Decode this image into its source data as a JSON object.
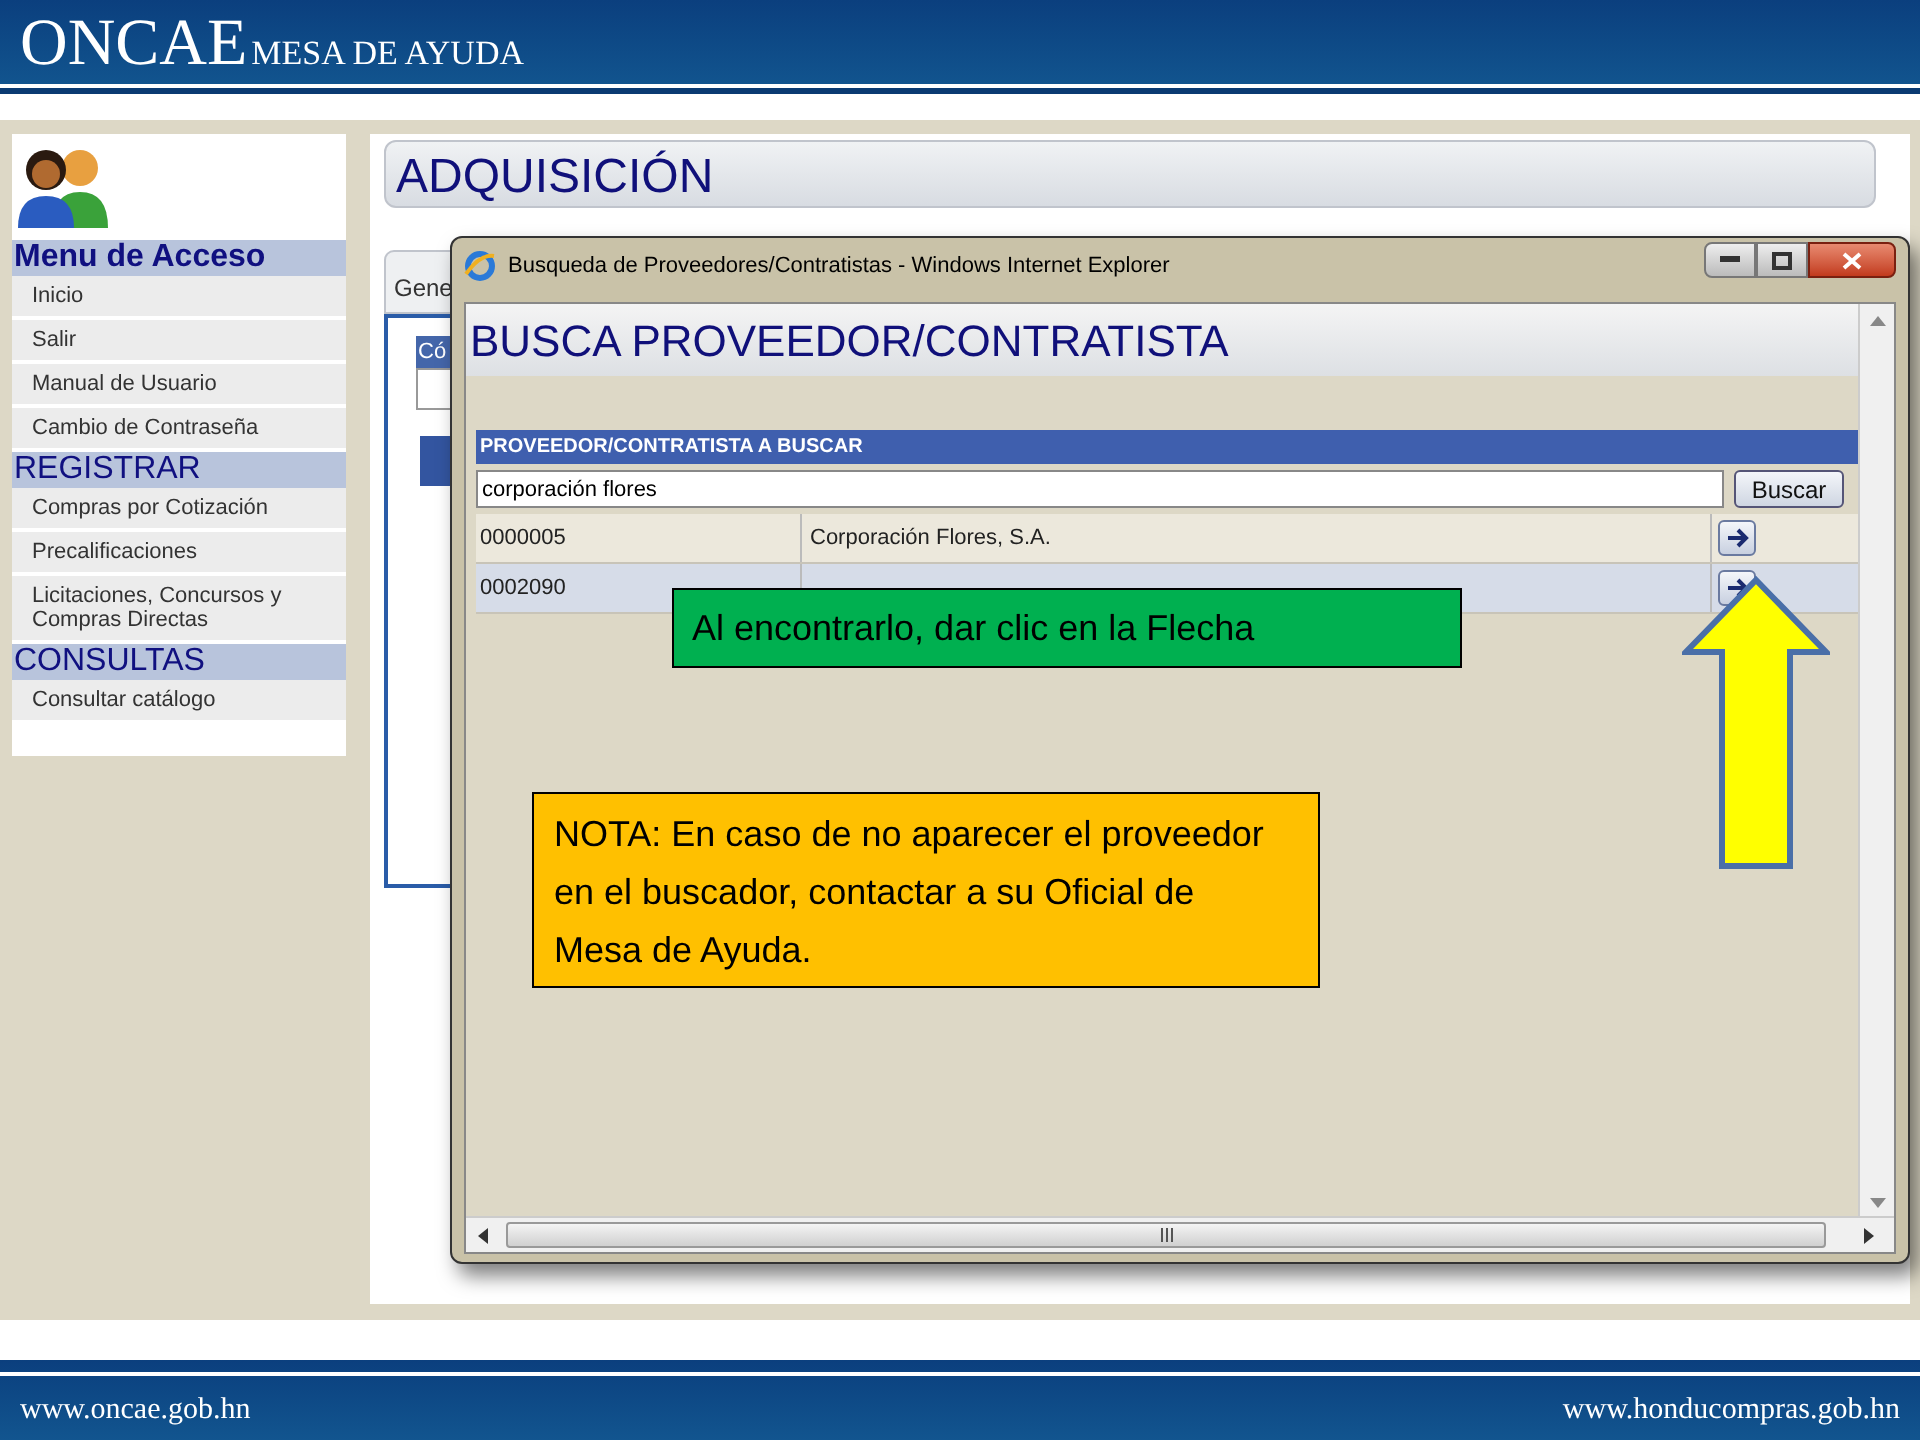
{
  "header": {
    "brand": "ONCAE",
    "subtitle": "MESA DE AYUDA"
  },
  "sidebar": {
    "sections": [
      {
        "title": "Menu de Acceso",
        "kind": "main",
        "items": [
          "Inicio",
          "Salir",
          "Manual de Usuario",
          "Cambio de Contraseña"
        ]
      },
      {
        "title": "REGISTRAR",
        "kind": "group",
        "items": [
          "Compras por Cotización",
          "Precalificaciones",
          "Licitaciones, Concursos y Compras Directas"
        ]
      },
      {
        "title": "CONSULTAS",
        "kind": "group",
        "items": [
          "Consultar catálogo"
        ]
      }
    ]
  },
  "page": {
    "title": "ADQUISICIÓN",
    "tab": "Gene",
    "field_label": "Có"
  },
  "popup": {
    "title": "Busqueda de Proveedores/Contratistas - Windows Internet Explorer",
    "heading": "BUSCA PROVEEDOR/CONTRATISTA",
    "section": "PROVEEDOR/CONTRATISTA A BUSCAR",
    "search_value": "corporación flores",
    "search_button": "Buscar",
    "results": [
      {
        "code": "0000005",
        "name": "Corporación Flores, S.A."
      },
      {
        "code": "0002090"
      }
    ]
  },
  "callouts": [
    {
      "kind": "tip",
      "text": "Al encontrarlo, dar clic en la Flecha",
      "color": "#00b050"
    },
    {
      "kind": "note",
      "text": "NOTA: En caso de no aparecer el proveedor en el buscador, contactar a su Oficial de Mesa de Ayuda.",
      "color": "#ffc000"
    }
  ],
  "footer": {
    "left": "www.oncae.gob.hn",
    "right": "www.honducompras.gob.hn"
  }
}
